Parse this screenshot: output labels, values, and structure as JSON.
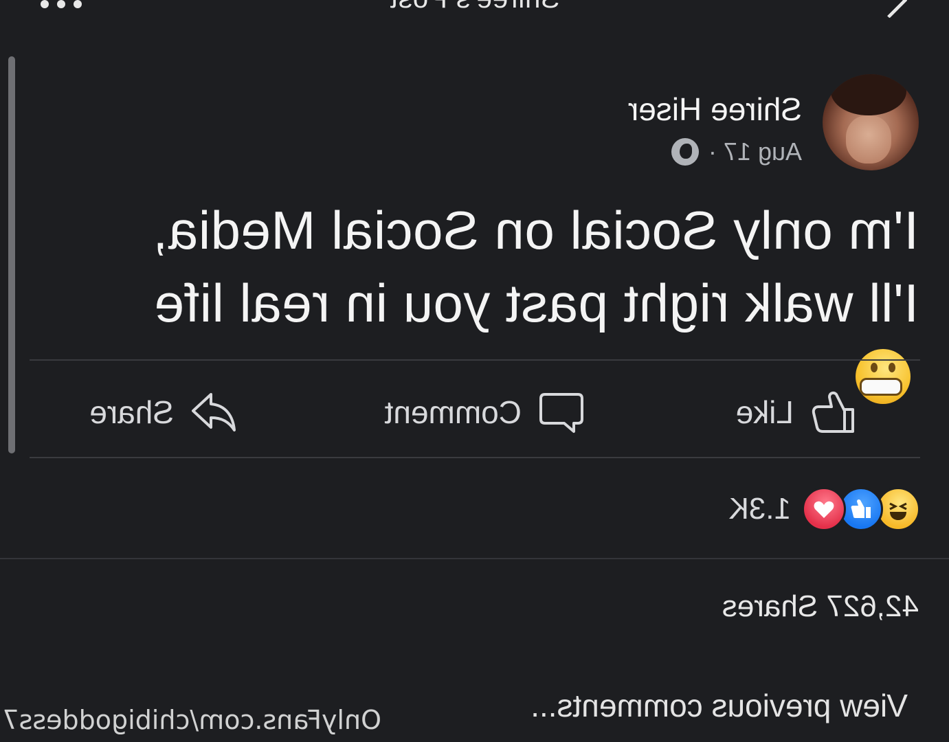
{
  "header": {
    "title": "Shiree's Post"
  },
  "post": {
    "author": "Shiree Hiser",
    "date": "Aug 17 ·",
    "audience_icon": "globe-icon",
    "text": "I'm only Social on Social Media, I'll walk right past you in real life",
    "emoji": "grimacing-face"
  },
  "actions": {
    "like_label": "Like",
    "comment_label": "Comment",
    "share_label": "Share"
  },
  "reactions": {
    "types": [
      "haha",
      "like",
      "love"
    ],
    "count": "1.3K"
  },
  "shares": {
    "label": "42,627 Shares"
  },
  "comments": {
    "view_previous_label": "View previous comments..."
  },
  "watermark": {
    "text": "OnlyFans.com/chibigoddess7"
  },
  "colors": {
    "background": "#1d1e21",
    "like_blue": "#1877f2",
    "love_red": "#e4304a",
    "haha_yellow": "#f7b928"
  }
}
